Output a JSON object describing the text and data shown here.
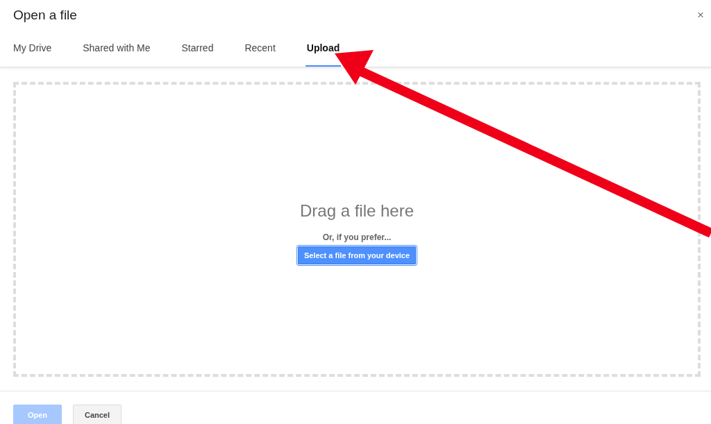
{
  "dialog": {
    "title": "Open a file",
    "close": "×"
  },
  "tabs": [
    {
      "label": "My Drive",
      "selected": false
    },
    {
      "label": "Shared with Me",
      "selected": false
    },
    {
      "label": "Starred",
      "selected": false
    },
    {
      "label": "Recent",
      "selected": false
    },
    {
      "label": "Upload",
      "selected": true
    }
  ],
  "dropzone": {
    "heading": "Drag a file here",
    "subheading": "Or, if you prefer...",
    "button": "Select a file from your device"
  },
  "buttons": [
    {
      "label": "Open",
      "kind": "primary",
      "disabled": true
    },
    {
      "label": "Cancel",
      "kind": "secondary",
      "disabled": false
    }
  ]
}
